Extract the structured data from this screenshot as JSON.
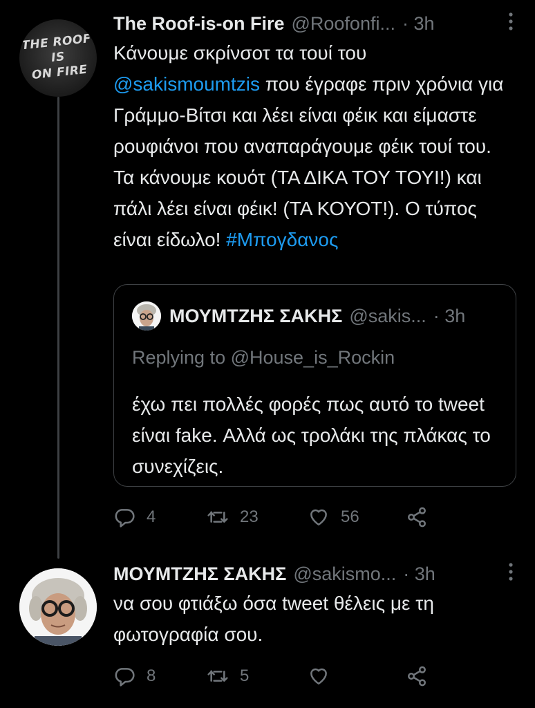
{
  "tweet1": {
    "author_name": "The Roof-is-on Fire",
    "author_handle": "@Roofonfi...",
    "time": "· 3h",
    "avatar_text": [
      "THE ROOF",
      "IS",
      "ON FIRE"
    ],
    "text_before_mention": "Κάνουμε σκρίνσοτ τα τουί του",
    "mention": "@sakismoumtzis",
    "text_after_mention": " που έγραφε πριν χρόνια για Γράμμο-Βίτσι και λέει είναι φέικ και είμαστε ρουφιάνοι που αναπαράγουμε φέικ τουί του. Τα κάνουμε κουότ (ΤΑ ΔΙΚΑ ΤΟΥ ΤΟΥΙ!) και πάλι λέει είναι φέικ! (ΤΑ ΚΟΥΟΤ!). Ο τύπος είναι είδωλο! ",
    "hashtag": "#Μπογδανος",
    "quote": {
      "author_name": "ΜΟΥΜΤΖΗΣ ΣΑΚΗΣ",
      "author_handle": "@sakis...",
      "time": "· 3h",
      "replying_prefix": "Replying to ",
      "replying_to": "@House_is_Rockin",
      "text": "έχω πει πολλές φορές πως αυτό το tweet είναι fake. Αλλά ως τρολάκι της πλάκας το συνεχίζεις."
    },
    "actions": {
      "replies": "4",
      "retweets": "23",
      "likes": "56"
    }
  },
  "tweet2": {
    "author_name": "ΜΟΥΜΤΖΗΣ ΣΑΚΗΣ",
    "author_handle": "@sakismo...",
    "time": "· 3h",
    "text": "να σου φτιάξω όσα tweet θέλεις με τη φωτογραφία σου.",
    "actions": {
      "replies": "8",
      "retweets": "5",
      "likes": ""
    }
  },
  "colors": {
    "background": "#000000",
    "text": "#e7e9ea",
    "muted": "#71767b",
    "link": "#1d9bf0",
    "border": "#3e4144"
  },
  "icons": [
    "reply-icon",
    "retweet-icon",
    "like-icon",
    "share-icon",
    "more-icon"
  ]
}
